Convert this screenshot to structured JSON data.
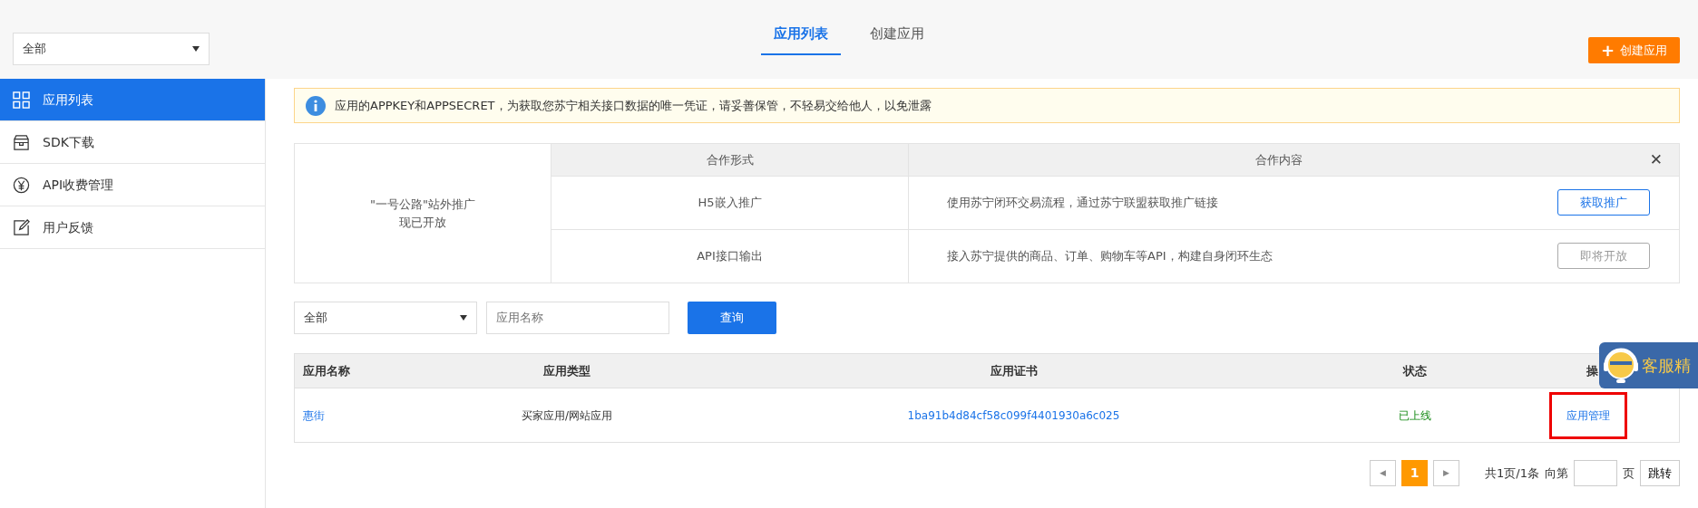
{
  "header": {
    "scope_select": {
      "value": "全部"
    },
    "tabs": [
      {
        "label": "应用列表",
        "selected": true
      },
      {
        "label": "创建应用",
        "selected": false
      }
    ],
    "create_button": {
      "icon": "+",
      "label": "创建应用"
    }
  },
  "sidebar": {
    "items": [
      {
        "label": "应用列表",
        "selected": true
      },
      {
        "label": "SDK下载",
        "selected": false
      },
      {
        "label": "API收费管理",
        "selected": false
      },
      {
        "label": "用户反馈",
        "selected": false
      }
    ]
  },
  "notice": {
    "text": "应用的APPKEY和APPSECRET，为获取您苏宁相关接口数据的唯一凭证，请妥善保管，不轻易交给他人，以免泄露"
  },
  "promo": {
    "title_lines": [
      "\"一号公路\"站外推广",
      "现已开放"
    ],
    "columns": [
      "合作形式",
      "合作内容"
    ],
    "close": "✕",
    "rows": [
      {
        "form": "H5嵌入推广",
        "content": "使用苏宁闭环交易流程，通过苏宁联盟获取推广链接",
        "button": "获取推广",
        "disabled": false
      },
      {
        "form": "API接口输出",
        "content": "接入苏宁提供的商品、订单、购物车等API，构建自身闭环生态",
        "button": "即将开放",
        "disabled": true
      }
    ]
  },
  "filter": {
    "type_select": {
      "value": "全部"
    },
    "name_field": {
      "placeholder": "应用名称"
    },
    "query_button": "查询"
  },
  "table": {
    "columns": [
      "应用名称",
      "应用类型",
      "应用证书",
      "状态",
      "操"
    ],
    "rows": [
      {
        "name": "惠街",
        "type": "买家应用/网站应用",
        "certificate": "1ba91b4d84cf58c099f4401930a6c025",
        "status": "已上线",
        "action": "应用管理",
        "highlighted": true
      }
    ]
  },
  "pagination": {
    "prev": "◀",
    "pages": [
      {
        "label": "1",
        "selected": true
      }
    ],
    "next": "▶",
    "summary": "共1页/1条",
    "goto_label": "向第",
    "page_unit": "页",
    "jump_button": "跳转"
  },
  "support_widget": {
    "label": "客服精"
  }
}
